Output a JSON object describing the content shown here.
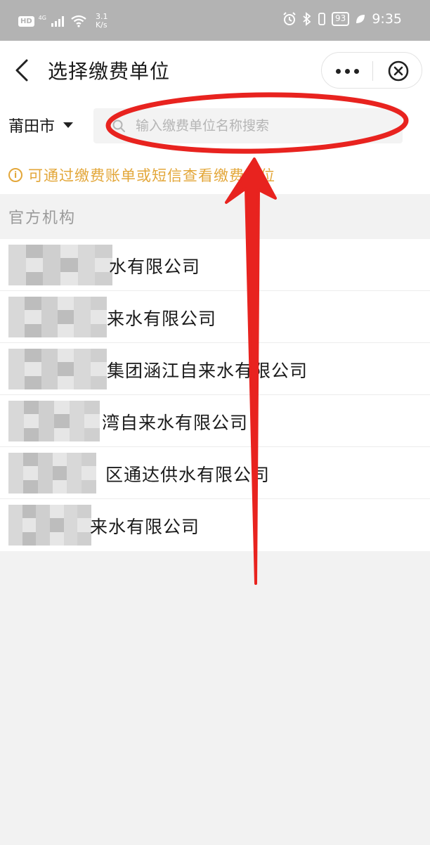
{
  "status_bar": {
    "hd": "HD",
    "network": "4G",
    "speed_value": "3.1",
    "speed_unit": "K/s",
    "battery": "93",
    "time": "9:35"
  },
  "header": {
    "title": "选择缴费单位",
    "back_icon": "chevron-left-icon",
    "more_icon": "more-dots-icon",
    "close_icon": "circle-close-icon"
  },
  "search": {
    "city": "莆田市",
    "placeholder": "输入缴费单位名称搜索",
    "value": ""
  },
  "tip": {
    "text": "可通过缴费账单或短信查看缴费单位",
    "color": "#e3a73a"
  },
  "section": {
    "title": "官方机构"
  },
  "companies": [
    {
      "prefix": "仙",
      "visible_name": "水有限公司"
    },
    {
      "prefix": "",
      "visible_name": "来水有限公司"
    },
    {
      "prefix": "",
      "visible_name": "集团涵江自来水有限公司"
    },
    {
      "prefix": "",
      "visible_name": "湾自来水有限公司"
    },
    {
      "prefix": "",
      "visible_name": "区通达供水有限公司"
    },
    {
      "prefix": "",
      "visible_name": "来水有限公司"
    }
  ],
  "annotation_color": "#e8231f"
}
